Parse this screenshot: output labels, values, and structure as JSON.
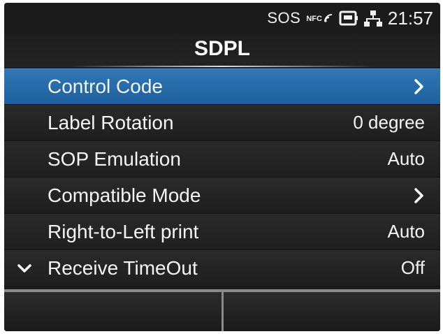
{
  "status_bar": {
    "sos": "SOS",
    "nfc_label": "NFC",
    "time": "21:57"
  },
  "page": {
    "title": "SDPL"
  },
  "menu": {
    "items": [
      {
        "label": "Control Code",
        "value": "",
        "indicator": "chevron-right-icon",
        "selected": true
      },
      {
        "label": "Label Rotation",
        "value": "0 degree",
        "indicator": "",
        "selected": false
      },
      {
        "label": "SOP Emulation",
        "value": "Auto",
        "indicator": "",
        "selected": false
      },
      {
        "label": "Compatible Mode",
        "value": "",
        "indicator": "chevron-right-icon",
        "selected": false
      },
      {
        "label": "Right-to-Left print",
        "value": "Auto",
        "indicator": "",
        "selected": false
      },
      {
        "label": "Receive TimeOut",
        "value": "Off",
        "indicator": "",
        "selected": false
      }
    ]
  },
  "colors": {
    "selected_row": "#2a6fae",
    "background": "#1b1b1b",
    "text": "#f4f4f4",
    "softkey_border": "#8a8a8a"
  }
}
